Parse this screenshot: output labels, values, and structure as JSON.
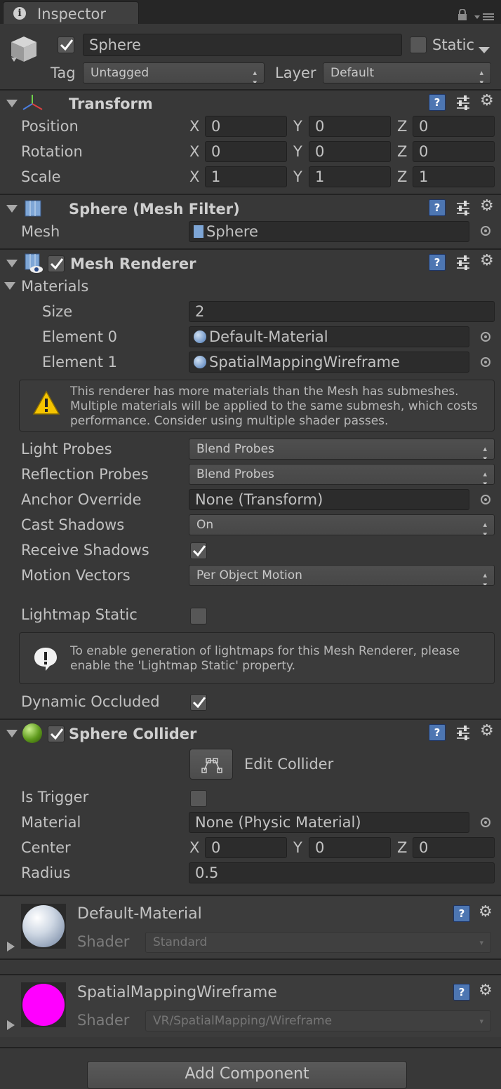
{
  "tab": {
    "title": "Inspector"
  },
  "object": {
    "name": "Sphere",
    "static_label": "Static",
    "tag_label": "Tag",
    "tag_value": "Untagged",
    "layer_label": "Layer",
    "layer_value": "Default",
    "active": true,
    "static": false
  },
  "transform": {
    "title": "Transform",
    "rows": [
      {
        "label": "Position",
        "x": "0",
        "y": "0",
        "z": "0"
      },
      {
        "label": "Rotation",
        "x": "0",
        "y": "0",
        "z": "0"
      },
      {
        "label": "Scale",
        "x": "1",
        "y": "1",
        "z": "1"
      }
    ],
    "axes": {
      "x": "X",
      "y": "Y",
      "z": "Z"
    }
  },
  "mesh_filter": {
    "title": "Sphere (Mesh Filter)",
    "mesh_label": "Mesh",
    "mesh_value": "Sphere"
  },
  "mesh_renderer": {
    "title": "Mesh Renderer",
    "enabled": true,
    "materials_label": "Materials",
    "size_label": "Size",
    "size_value": "2",
    "elements": [
      {
        "label": "Element 0",
        "value": "Default-Material"
      },
      {
        "label": "Element 1",
        "value": "SpatialMappingWireframe"
      }
    ],
    "warning": {
      "line1": "This renderer has more materials than the Mesh has submeshes.",
      "line2": "Multiple materials will be applied to the same submesh, which costs",
      "line3": "performance. Consider using multiple shader passes."
    },
    "light_probes_label": "Light Probes",
    "light_probes_value": "Blend Probes",
    "reflection_probes_label": "Reflection Probes",
    "reflection_probes_value": "Blend Probes",
    "anchor_override_label": "Anchor Override",
    "anchor_override_value": "None (Transform)",
    "cast_shadows_label": "Cast Shadows",
    "cast_shadows_value": "On",
    "receive_shadows_label": "Receive Shadows",
    "receive_shadows": true,
    "motion_vectors_label": "Motion Vectors",
    "motion_vectors_value": "Per Object Motion",
    "lightmap_static_label": "Lightmap Static",
    "lightmap_static": false,
    "info": {
      "line1": "To enable generation of lightmaps for this Mesh Renderer, please",
      "line2": "enable the 'Lightmap Static' property."
    },
    "dynamic_occluded_label": "Dynamic Occluded",
    "dynamic_occluded": true
  },
  "sphere_collider": {
    "title": "Sphere Collider",
    "enabled": true,
    "edit_collider_label": "Edit Collider",
    "is_trigger_label": "Is Trigger",
    "is_trigger": false,
    "material_label": "Material",
    "material_value": "None (Physic Material)",
    "center_label": "Center",
    "center": {
      "x": "0",
      "y": "0",
      "z": "0"
    },
    "radius_label": "Radius",
    "radius_value": "0.5"
  },
  "materials": [
    {
      "name": "Default-Material",
      "shader_label": "Shader",
      "shader": "Standard",
      "swatch_color": "#dfe6ef"
    },
    {
      "name": "SpatialMappingWireframe",
      "shader_label": "Shader",
      "shader": "VR/SpatialMapping/Wireframe",
      "swatch_color": "#ff00ff"
    }
  ],
  "add_component_label": "Add Component",
  "colors": {
    "background": "#383838",
    "help_icon": "#4d76b2",
    "warning": "#f5c400"
  }
}
